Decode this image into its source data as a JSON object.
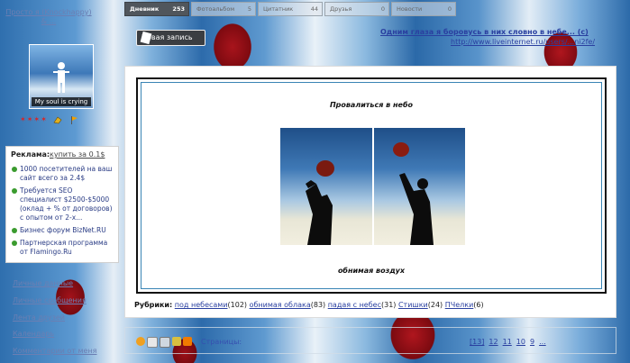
{
  "sidebar": {
    "username": "Просто я (Knockhappy) & ...",
    "avatar_caption": "My soul is crying",
    "ad": {
      "heading": "Реклама:",
      "buy_link": "купить за 0.1$",
      "items": [
        {
          "text": "1000 посетителей на ваш сайт всего за 2.4$"
        },
        {
          "text": "Требуется SEO специалист $2500-$5000 (оклад + % от договоров) с опытом от 2-х..."
        },
        {
          "text": "Бизнес форум BizNet.RU"
        },
        {
          "text": "Партнерская программа от Flamingo.Ru"
        }
      ]
    },
    "links": [
      "Личные данные",
      "Личные сообщения",
      "Лента друзей",
      "Календарь",
      "Комментарии от меня"
    ]
  },
  "tabs": [
    {
      "label": "Дневник",
      "count": "253"
    },
    {
      "label": "Фотоальбом",
      "count": "5"
    },
    {
      "label": "Цитатник",
      "count": "44"
    },
    {
      "label": "Друзья",
      "count": "0"
    },
    {
      "label": "Новости",
      "count": "0"
    }
  ],
  "new_post_label": "Новая запись",
  "header_links": {
    "title": "Одним глаза я боровусь в них словно в небе... (с)",
    "url": "http://www.liveinternet.ru/users/...ni2fe/"
  },
  "post": {
    "title": "Провалиться в небо",
    "footer": "обнимая воздух"
  },
  "rubrics": {
    "label": "Рубрики:",
    "items": [
      {
        "name": "под небесами",
        "count": "(102)"
      },
      {
        "name": "обнимая облака",
        "count": "(83)"
      },
      {
        "name": "падая с небес",
        "count": "(31)"
      },
      {
        "name": "Стишки",
        "count": "(24)"
      },
      {
        "name": "ПЧелки",
        "count": "(6)"
      }
    ]
  },
  "bottom": {
    "pages_label": "Страницы:",
    "pages": [
      "[13]",
      "12",
      "11",
      "10",
      "9",
      "..."
    ]
  },
  "colors": {
    "link": "#2a40a0",
    "tab_active": "#50565c",
    "ad_bullet": "#3a9b2e"
  }
}
